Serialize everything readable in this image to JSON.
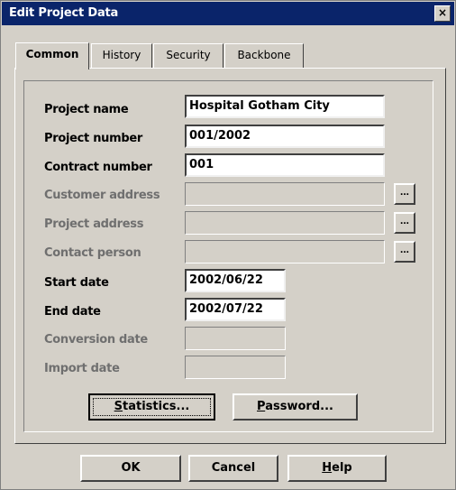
{
  "window": {
    "title": "Edit Project Data",
    "close_glyph": "×"
  },
  "tabs": [
    {
      "label": "Common",
      "active": true
    },
    {
      "label": "History",
      "active": false
    },
    {
      "label": "Security",
      "active": false
    },
    {
      "label": "Backbone",
      "active": false
    }
  ],
  "fields": {
    "project_name": {
      "label": "Project name",
      "value": "Hospital Gotham City"
    },
    "project_number": {
      "label": "Project number",
      "value": "001/2002"
    },
    "contract_number": {
      "label": "Contract number",
      "value": "001"
    },
    "customer_address": {
      "label": "Customer address",
      "value": ""
    },
    "project_address": {
      "label": "Project address",
      "value": ""
    },
    "contact_person": {
      "label": "Contact person",
      "value": ""
    },
    "start_date": {
      "label": "Start date",
      "value": "2002/06/22"
    },
    "end_date": {
      "label": "End date",
      "value": "2002/07/22"
    },
    "conversion_date": {
      "label": "Conversion date",
      "value": ""
    },
    "import_date": {
      "label": "Import date",
      "value": ""
    }
  },
  "browse_button_label": "...",
  "buttons": {
    "statistics": {
      "mnemonic": "S",
      "rest": "tatistics..."
    },
    "password": {
      "mnemonic": "P",
      "rest": "assword..."
    },
    "ok": "OK",
    "cancel": "Cancel",
    "help": {
      "mnemonic": "H",
      "rest": "elp"
    }
  }
}
